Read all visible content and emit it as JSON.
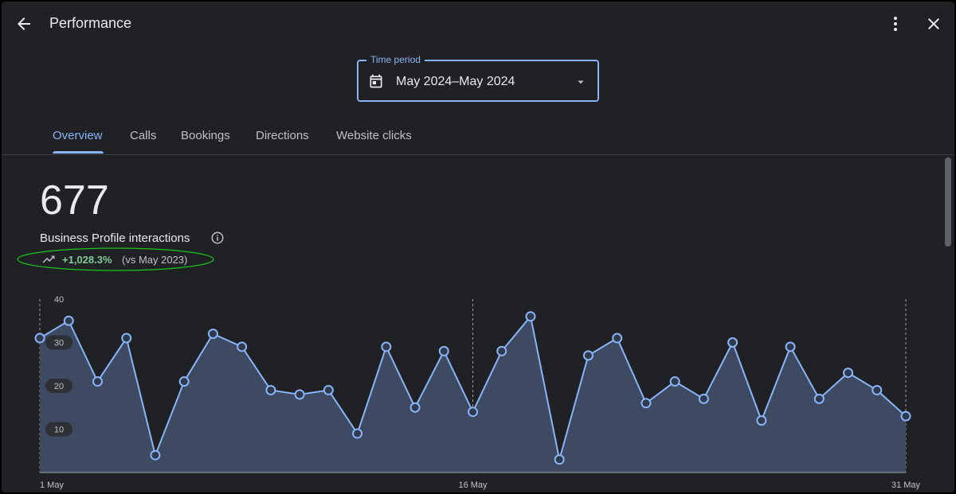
{
  "header": {
    "title": "Performance",
    "back_icon": "arrow-back-icon",
    "more_icon": "more-vert-icon",
    "close_icon": "close-icon"
  },
  "time_period": {
    "label": "Time period",
    "value": "May 2024–May 2024",
    "icon": "calendar-icon"
  },
  "tabs": [
    {
      "label": "Overview",
      "active": true
    },
    {
      "label": "Calls",
      "active": false
    },
    {
      "label": "Bookings",
      "active": false
    },
    {
      "label": "Directions",
      "active": false
    },
    {
      "label": "Website clicks",
      "active": false
    }
  ],
  "summary": {
    "total": "677",
    "metric_label": "Business Profile interactions",
    "change": "+1,028.3%",
    "comparison": "(vs May 2023)",
    "change_color": "#81c995"
  },
  "colors": {
    "accent": "#8ab4f8",
    "background": "#202124",
    "line": "#8ab4f8",
    "area_fill": "#3d4a62",
    "highlight": "#1ec31e"
  },
  "chart_data": {
    "type": "area",
    "x": [
      "1 May",
      "2 May",
      "3 May",
      "4 May",
      "5 May",
      "6 May",
      "7 May",
      "8 May",
      "9 May",
      "10 May",
      "11 May",
      "12 May",
      "13 May",
      "14 May",
      "15 May",
      "16 May",
      "17 May",
      "18 May",
      "19 May",
      "20 May",
      "21 May",
      "22 May",
      "23 May",
      "24 May",
      "25 May",
      "26 May",
      "27 May",
      "28 May",
      "29 May",
      "30 May",
      "31 May"
    ],
    "values": [
      31,
      35,
      21,
      31,
      4,
      21,
      32,
      29,
      19,
      18,
      19,
      9,
      29,
      15,
      28,
      14,
      28,
      36,
      3,
      27,
      31,
      16,
      21,
      17,
      30,
      12,
      29,
      17,
      23,
      19,
      13
    ],
    "x_tick_labels": [
      "1 May",
      "16 May",
      "31 May"
    ],
    "y_tick_labels": [
      "10",
      "20",
      "30",
      "40"
    ],
    "ylim": [
      0,
      40
    ],
    "grid": false
  }
}
